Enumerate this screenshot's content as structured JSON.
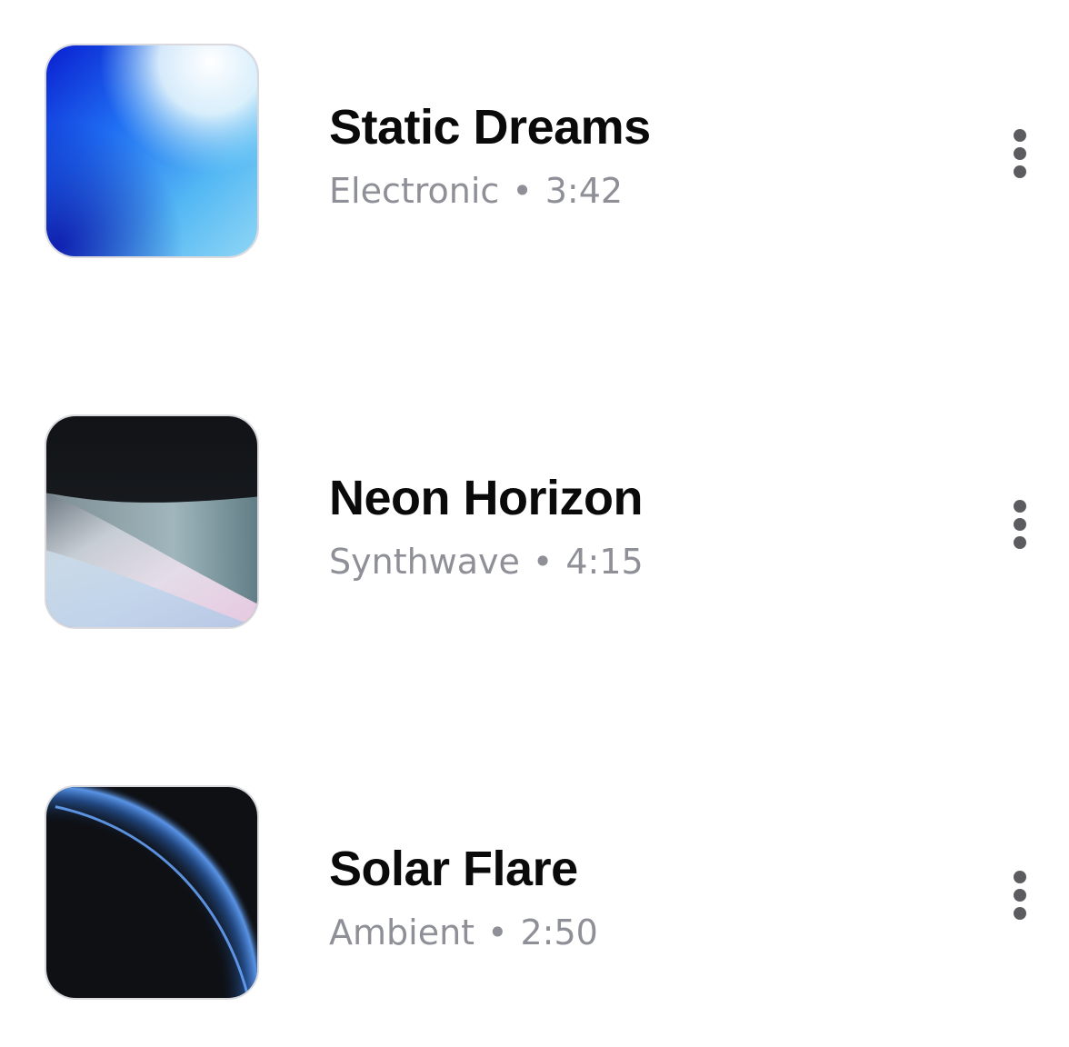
{
  "tracks": [
    {
      "title": "Static Dreams",
      "genre": "Electronic",
      "separator": "•",
      "duration": "3:42",
      "cover_style": "blue-gradient",
      "menu_icon": "more-vertical-icon"
    },
    {
      "title": "Neon Horizon",
      "genre": "Synthwave",
      "separator": "•",
      "duration": "4:15",
      "cover_style": "dark-wave-pastel",
      "menu_icon": "more-vertical-icon"
    },
    {
      "title": "Solar Flare",
      "genre": "Ambient",
      "separator": "•",
      "duration": "2:50",
      "cover_style": "dark-blue-arc",
      "menu_icon": "more-vertical-icon"
    }
  ],
  "colors": {
    "title": "#0a0a0a",
    "meta": "#8f9097",
    "menu_dots": "#5c5c60",
    "cover_border": "#d9d9de"
  }
}
